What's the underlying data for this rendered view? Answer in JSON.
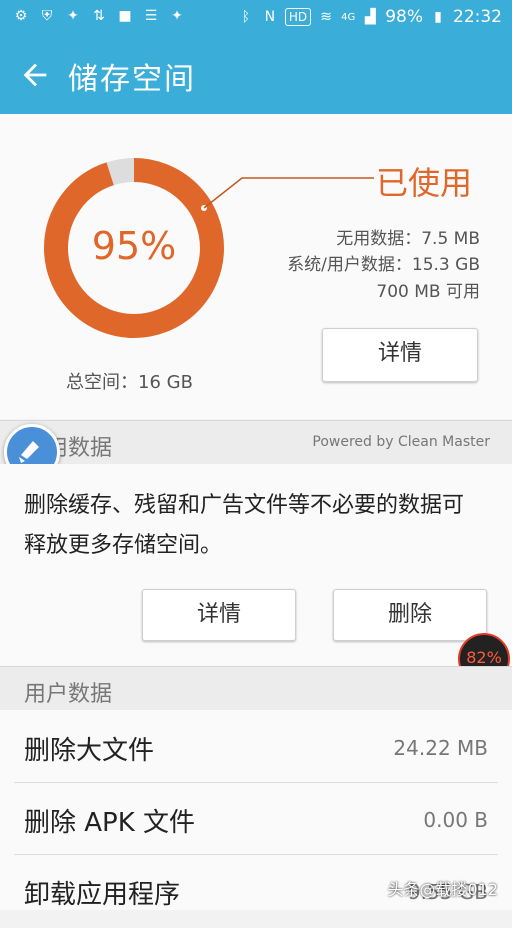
{
  "status_bar": {
    "battery": "98%",
    "time": "22:32",
    "hd": "HD",
    "network": "4G"
  },
  "app_bar": {
    "title": "储存空间"
  },
  "storage": {
    "percent_used": 95,
    "percent_label": "95%",
    "used_title": "已使用",
    "junk_data": "无用数据：7.5 MB",
    "system_user_data": "系统/用户数据：15.3 GB",
    "available": "700 MB 可用",
    "details_button": "详情",
    "total": "总空间：16 GB"
  },
  "useless_section": {
    "header": "无用数据",
    "powered_by": "Powered by Clean Master",
    "description": "删除缓存、残留和广告文件等不必要的数据可释放更多存储空间。",
    "details_button": "详情",
    "delete_button": "删除"
  },
  "floating_badge": {
    "label": "82%"
  },
  "user_section": {
    "header": "用户数据",
    "items": [
      {
        "label": "删除大文件",
        "value": "24.22 MB"
      },
      {
        "label": "删除 APK 文件",
        "value": "0.00 B"
      },
      {
        "label": "卸载应用程序",
        "value": "9.55 GB"
      }
    ]
  },
  "watermark": "头条@载搂012",
  "colors": {
    "accent": "#3aaed8",
    "orange": "#e0672a",
    "free": "#dddddd"
  }
}
